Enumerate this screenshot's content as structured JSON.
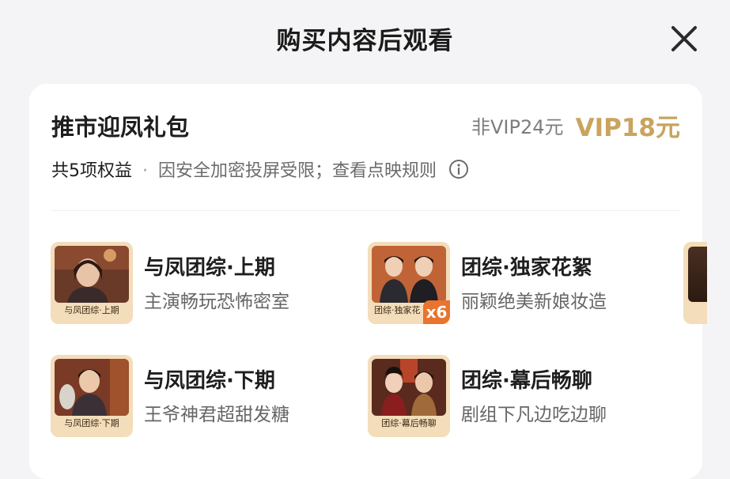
{
  "header": {
    "title": "购买内容后观看"
  },
  "package": {
    "name": "推市迎凤礼包",
    "price_nonvip": "非VIP24元",
    "price_vip": "VIP18元",
    "benefits_count": "共5项权益",
    "separator": "·",
    "notice": "因安全加密投屏受限；查看点映规则"
  },
  "items": [
    {
      "title": "与凤团综·上期",
      "subtitle": "主演畅玩恐怖密室",
      "caption": "与凤团综·上期"
    },
    {
      "title": "团综·独家花絮",
      "subtitle": "丽颖绝美新娘妆造",
      "caption": "团综·独家花",
      "badge": "x6"
    },
    {
      "title": "与凤团综·下期",
      "subtitle": "王爷神君超甜发糖",
      "caption": "与凤团综·下期"
    },
    {
      "title": "团综·幕后畅聊",
      "subtitle": "剧组下凡边吃边聊",
      "caption": "团综·幕后畅聊"
    }
  ],
  "colors": {
    "vip_gold": "#c9a45e",
    "thumb_frame": "#f3ddba",
    "badge": "#e8742d"
  }
}
